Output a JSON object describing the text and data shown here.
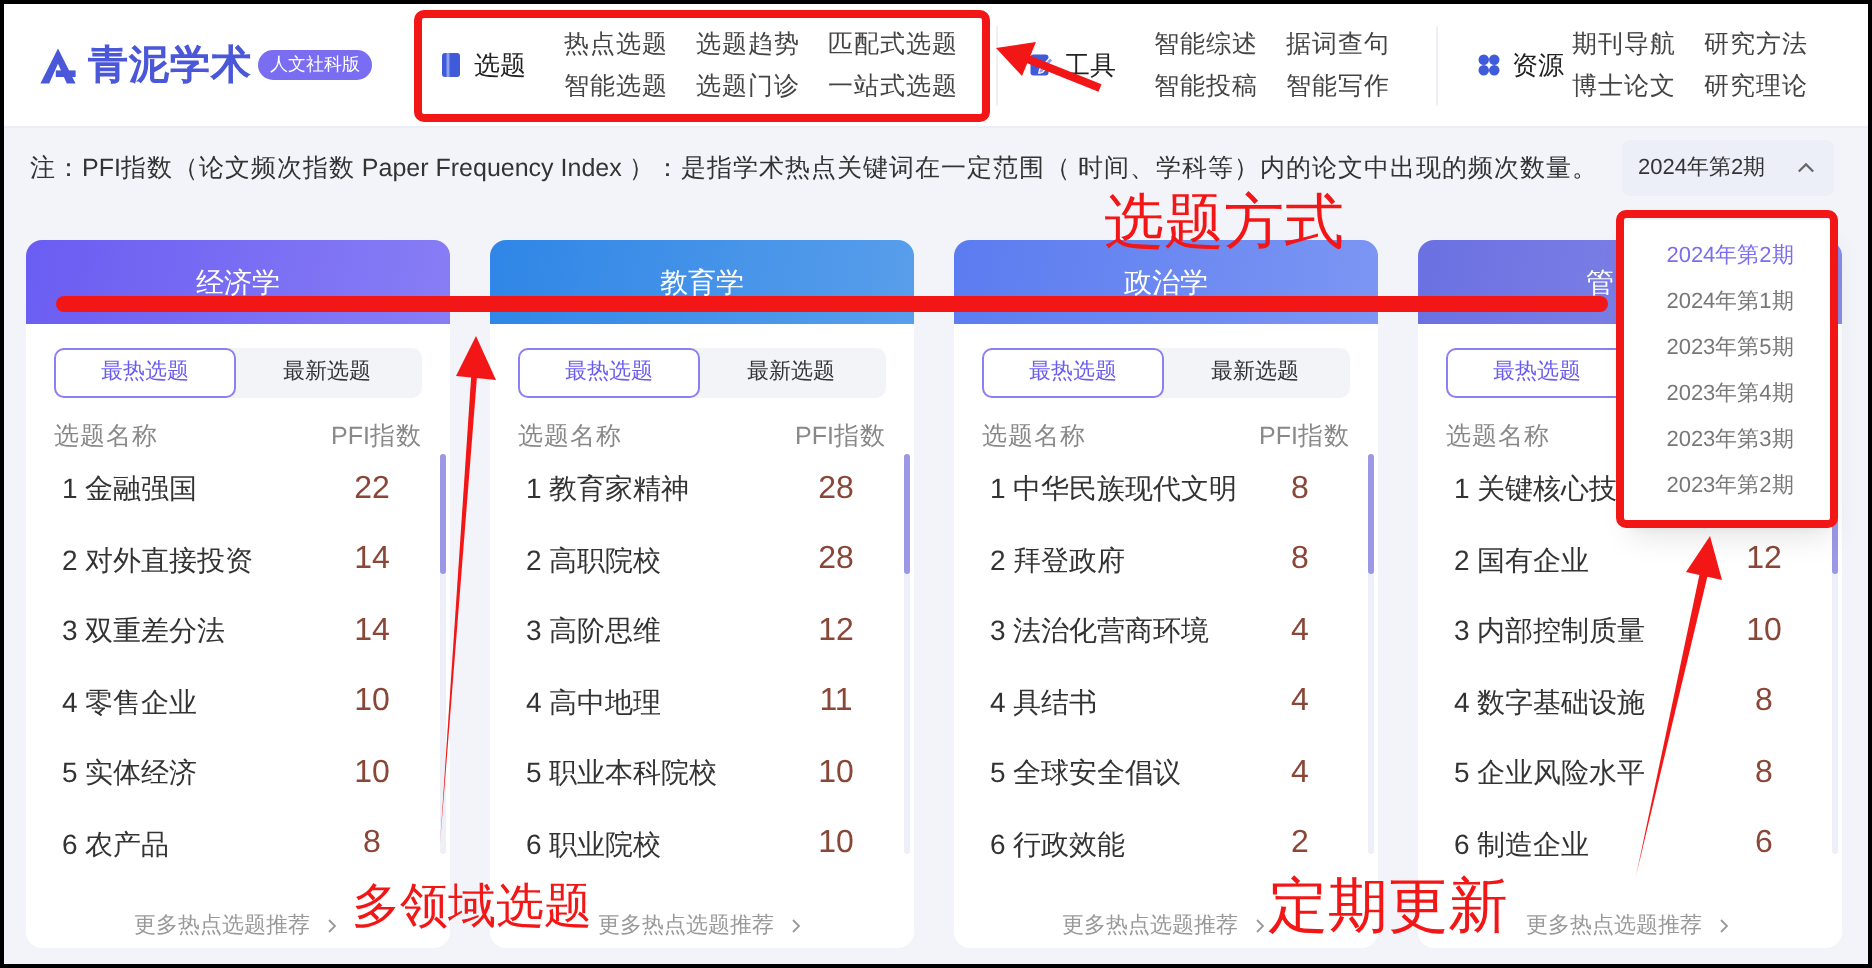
{
  "header": {
    "brand": "青泥学术",
    "badge": "人文社科版",
    "nav": [
      {
        "label": "选题",
        "links": [
          "热点选题",
          "选题趋势",
          "匹配式选题",
          "智能选题",
          "选题门诊",
          "一站式选题"
        ]
      },
      {
        "label": "工具",
        "links": [
          "智能综述",
          "据词查句",
          "智能投稿",
          "智能写作"
        ]
      },
      {
        "label": "资源",
        "links": [
          "期刊导航",
          "研究方法",
          "博士论文",
          "研究理论"
        ]
      }
    ]
  },
  "note": "注：PFI指数（论文频次指数 Paper Frequency Index ）：是指学术热点关键词在一定范围（ 时间、学科等）内的论文中出现的频次数量。",
  "period": {
    "value": "2024年第2期",
    "expanded": true,
    "options": [
      {
        "label": "2024年第2期",
        "selected": true
      },
      {
        "label": "2024年第1期",
        "selected": false
      },
      {
        "label": "2023年第5期",
        "selected": false
      },
      {
        "label": "2023年第4期",
        "selected": false
      },
      {
        "label": "2023年第3期",
        "selected": false
      },
      {
        "label": "2023年第2期",
        "selected": false
      }
    ]
  },
  "cards": [
    {
      "title": "经济学",
      "color": "#6a5df2",
      "tabs": [
        {
          "label": "最热选题",
          "selected": true
        },
        {
          "label": "最新选题",
          "selected": false
        }
      ],
      "columns": [
        "选题名称",
        "PFI指数"
      ],
      "rows": [
        {
          "name": "1 金融强国",
          "pfi": "22"
        },
        {
          "name": "2 对外直接投资",
          "pfi": "14"
        },
        {
          "name": "3 双重差分法",
          "pfi": "14"
        },
        {
          "name": "4 零售企业",
          "pfi": "10"
        },
        {
          "name": "5 实体经济",
          "pfi": "10"
        },
        {
          "name": "6 农产品",
          "pfi": "8"
        }
      ],
      "more": "更多热点选题推荐"
    },
    {
      "title": "教育学",
      "color": "#2f86e6",
      "tabs": [
        {
          "label": "最热选题",
          "selected": true
        },
        {
          "label": "最新选题",
          "selected": false
        }
      ],
      "columns": [
        "选题名称",
        "PFI指数"
      ],
      "rows": [
        {
          "name": "1 教育家精神",
          "pfi": "28"
        },
        {
          "name": "2 高职院校",
          "pfi": "28"
        },
        {
          "name": "3 高阶思维",
          "pfi": "12"
        },
        {
          "name": "4 高中地理",
          "pfi": "11"
        },
        {
          "name": "5 职业本科院校",
          "pfi": "10"
        },
        {
          "name": "6 职业院校",
          "pfi": "10"
        }
      ],
      "more": "更多热点选题推荐"
    },
    {
      "title": "政治学",
      "color": "#5b7cf0",
      "tabs": [
        {
          "label": "最热选题",
          "selected": true
        },
        {
          "label": "最新选题",
          "selected": false
        }
      ],
      "columns": [
        "选题名称",
        "PFI指数"
      ],
      "rows": [
        {
          "name": "1 中华民族现代文明",
          "pfi": "8"
        },
        {
          "name": "2 拜登政府",
          "pfi": "8"
        },
        {
          "name": "3 法治化营商环境",
          "pfi": "4"
        },
        {
          "name": "4 具结书",
          "pfi": "4"
        },
        {
          "name": "5 全球安全倡议",
          "pfi": "4"
        },
        {
          "name": "6 行政效能",
          "pfi": "2"
        }
      ],
      "more": "更多热点选题推荐"
    },
    {
      "title": "管",
      "color": "#6b70e2",
      "tabs": [
        {
          "label": "最热选题",
          "selected": true
        }
      ],
      "columns": [
        "选题名称"
      ],
      "rows": [
        {
          "name": "1 关键核心技"
        },
        {
          "name": "2 国有企业",
          "pfi": "12"
        },
        {
          "name": "3 内部控制质量",
          "pfi": "10"
        },
        {
          "name": "4 数字基础设施",
          "pfi": "8"
        },
        {
          "name": "5 企业风险水平",
          "pfi": "8"
        },
        {
          "name": "6 制造企业",
          "pfi": "6"
        }
      ],
      "more": "更多热点选题推荐"
    }
  ],
  "annotations": [
    "选题方式",
    "多领域选题",
    "定期更新"
  ]
}
